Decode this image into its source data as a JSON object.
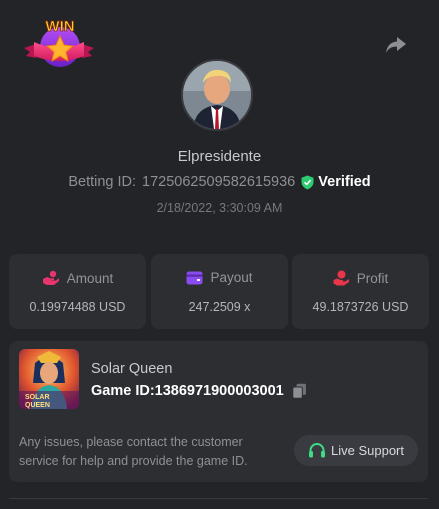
{
  "header": {
    "logo_text": "WIN",
    "share_icon": "share-arrow-icon"
  },
  "profile": {
    "username": "Elpresidente",
    "betting_label": "Betting ID:",
    "betting_id": "1725062509582615936",
    "verified_label": "Verified",
    "timestamp": "2/18/2022, 3:30:09 AM"
  },
  "stats": [
    {
      "icon": "amount-hand-icon",
      "label": "Amount",
      "value": "0.19974488 USD",
      "color": "#e8356d"
    },
    {
      "icon": "payout-wallet-icon",
      "label": "Payout",
      "value": "247.2509 x",
      "color": "#8a4cf0"
    },
    {
      "icon": "profit-coin-hand-icon",
      "label": "Profit",
      "value": "49.1873726 USD",
      "color": "#e8354a"
    }
  ],
  "game": {
    "name": "Solar Queen",
    "id_label": "Game ID:",
    "id": "1386971900003001",
    "thumb_title_line1": "SOLAR",
    "thumb_title_line2": "QUEEN",
    "notice": "Any issues, please contact the customer service for help and provide the game ID.",
    "support_label": "Live Support"
  },
  "colors": {
    "background": "#232427",
    "card": "#2d2e32",
    "verified_green": "#2ecc71",
    "support_green": "#3ddc84"
  }
}
